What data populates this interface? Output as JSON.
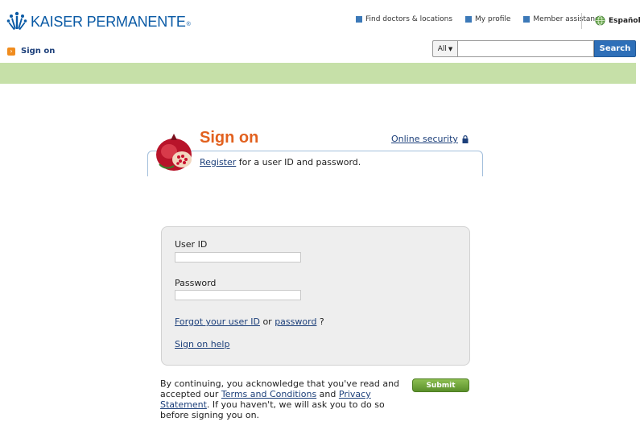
{
  "header": {
    "brand_name": "KAISER PERMANENTE",
    "brand_mark": "®",
    "brand_color": "#0a5aa5",
    "nav": [
      {
        "label": "Find doctors & locations"
      },
      {
        "label": "My profile"
      },
      {
        "label": "Member assistance"
      }
    ],
    "language": "Español"
  },
  "breadcrumb": {
    "label": "Sign on"
  },
  "search": {
    "scope": "All",
    "value": "",
    "button": "Search"
  },
  "signon": {
    "title": "Sign on",
    "online_security": "Online security",
    "register_link": "Register",
    "register_rest": " for a user ID and password."
  },
  "form": {
    "user_id_label": "User ID",
    "user_id_value": "",
    "password_label": "Password",
    "password_value": "",
    "forgot_user_id": "Forgot your user ID",
    "or_text": " or ",
    "forgot_password": "password",
    "question_mark": " ?",
    "help_link": "Sign on help"
  },
  "legal": {
    "part1": "By continuing, you acknowledge that you've read and accepted our ",
    "terms": "Terms and Conditions",
    "and": " and ",
    "privacy": "Privacy Statement",
    "part2": ". If you haven't, we will ask you to do so before signing you on."
  },
  "submit_label": "Submit",
  "colors": {
    "accent_orange": "#e2611f",
    "green_band": "#c6e0a8",
    "search_blue": "#2e6fb8",
    "submit_green": "#6fa23a"
  }
}
